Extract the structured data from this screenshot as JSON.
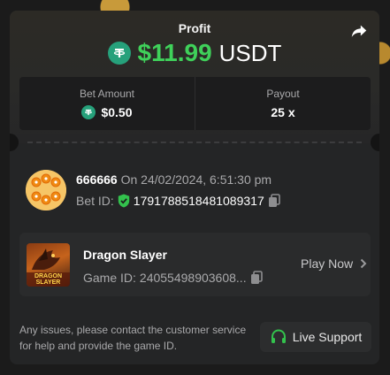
{
  "header": {
    "title": "Profit",
    "amount": "$11.99",
    "currency": "USDT"
  },
  "stats": {
    "bet_label": "Bet Amount",
    "bet_value": "$0.50",
    "payout_label": "Payout",
    "payout_value": "25 x"
  },
  "user": {
    "name": "666666",
    "date": "On 24/02/2024, 6:51:30 pm",
    "bet_id_label": "Bet ID:",
    "bet_id": "1791788518481089317"
  },
  "game": {
    "name": "Dragon Slayer",
    "id_label": "Game ID:",
    "id": "24055498903608...",
    "play_label": "Play Now",
    "thumb_text": "DRAGON SLAYER"
  },
  "support": {
    "text": "Any issues, please contact the customer service for help and provide the game ID.",
    "button_label": "Live Support"
  },
  "colors": {
    "profit_green": "#3fd15a",
    "usdt_green": "#26a17b",
    "verified_green": "#33c24d",
    "card_bg": "#242526"
  },
  "icons": {
    "share": "share-icon",
    "currency": "usdt-icon",
    "verified": "shield-check-icon",
    "copy": "copy-icon",
    "chevron": "chevron-right-icon",
    "headset": "headset-icon"
  }
}
